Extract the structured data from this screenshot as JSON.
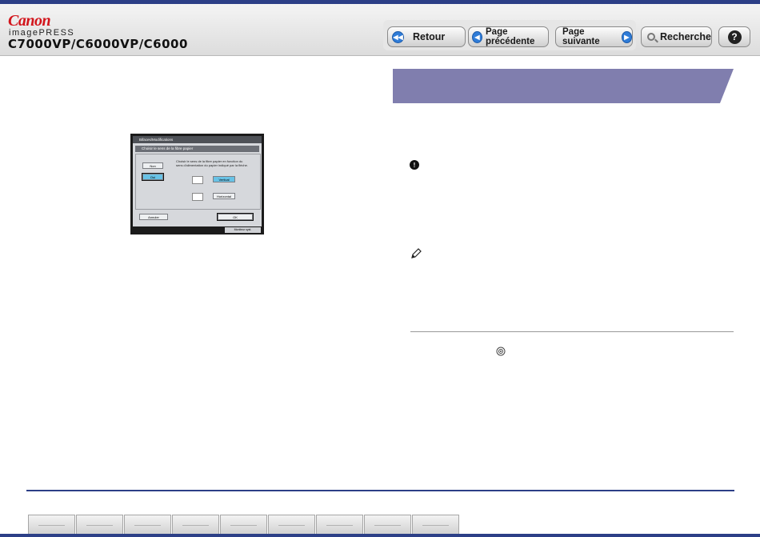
{
  "header": {
    "brand": "Canon",
    "product": "imagePRESS",
    "models": "C7000VP/C6000VP/C6000"
  },
  "nav": {
    "back": "Retour",
    "prev": "Page précédente",
    "next": "Page suivante",
    "search": "Recherche",
    "help": "?"
  },
  "screenshot": {
    "title": "Bifaces/Modifications",
    "subtitle": "Choisir le sens de la fibre papier",
    "no_button": "Non",
    "yes_button": "Oui",
    "description": "Choisir le sens de la fibre papier en fonction du sens d'alimentation du papier indiqué par la flèche.",
    "vertical_button": "Vertical",
    "horizontal_button": "Horizontal",
    "cancel_button": "Annuler",
    "ok_button": "OK",
    "status": "Moniteur syst."
  },
  "icons": {
    "important": "important-icon",
    "note": "pencil-note-icon",
    "gear": "gear-icon"
  },
  "colors": {
    "accent": "#2c3f87",
    "section_header": "#807eae",
    "brand_red": "#d2151c",
    "nav_blue": "#2f7cd8"
  }
}
